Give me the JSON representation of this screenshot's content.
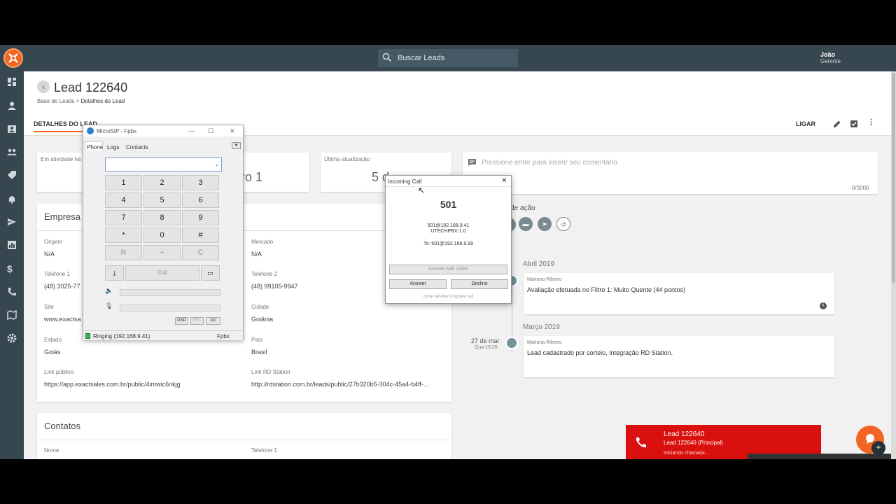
{
  "topbar": {
    "search_placeholder": "Buscar Leads",
    "user_name": "João",
    "user_role": "Gerente"
  },
  "header": {
    "title": "Lead 122640",
    "breadcrumb": [
      "Base de Leads",
      "Detalhes do Lead"
    ],
    "tab": "DETALHES DO LEAD",
    "ligar": "LIGAR"
  },
  "stats": {
    "activity_label": "Em atividade há",
    "filter_value": "ro 1",
    "update_label": "Última atualização",
    "update_value": "5 d"
  },
  "company": {
    "section": "Empresa",
    "origem_label": "Origem",
    "origem": "N/A",
    "mercado_label": "Mercado",
    "mercado": "N/A",
    "tel1_label": "Telefone 1",
    "tel1": "(48) 3025-77",
    "tel2_label": "Telefone 2",
    "tel2": "(48) 99105-9947",
    "site_label": "Site",
    "site": "www.exactsa",
    "cidade_label": "Cidade",
    "cidade": "Goiânia",
    "estado_label": "Estado",
    "estado": "Goiás",
    "pais_label": "País",
    "pais": "Brasil",
    "link_pub_label": "Link público",
    "link_pub": "https://app.exactsales.com.br/public/4imwic6nkjg",
    "link_rd_label": "Link RD Station",
    "link_rd": "http://rdstation.com.br/leads/public/27b320b5-304c-45a4-b4ff-..."
  },
  "contacts": {
    "section": "Contatos",
    "nome_label": "Nome",
    "tel_label": "Telefone 1"
  },
  "comment": {
    "placeholder": "Pressione enter para inserir seu comentário",
    "counter": "0/3000"
  },
  "timeline": {
    "actions_label": "de ação",
    "month1": "Abril 2019",
    "ev1_author": "Mariana Ribeiro",
    "ev1_text": "Avaliação efetuada no Filtro 1: Muito Quente (44 pontos)",
    "month2": "Março 2019",
    "ev2_date": "27 de mar",
    "ev2_time": "Qua 15:25",
    "ev2_author": "Mariana Ribeiro",
    "ev2_text": "Lead cadastrado por sorteio, Integração RD Station."
  },
  "microsip": {
    "title": "MicroSIP - Fpbx",
    "tabs": [
      "Phone",
      "Logs",
      "Contacts"
    ],
    "keys": [
      "1",
      "2",
      "3",
      "4",
      "5",
      "6",
      "7",
      "8",
      "9",
      "*",
      "0",
      "#",
      "R",
      "+",
      "C"
    ],
    "call": "Call",
    "dnd": "DND",
    "rec": "REC",
    "status": "Ringing (192.168.9.41)",
    "account": "Fpbx"
  },
  "incoming": {
    "title": "Incoming Call",
    "number": "501",
    "from": "501@192.168.9.41",
    "agent": "UTECHPBX-1.0",
    "to": "To: 501@192.168.9.99",
    "answer_video": "Answer with Video",
    "answer": "Answer",
    "decline": "Decline",
    "close_hint": "close window to ignore call"
  },
  "toast": {
    "title": "Lead 122640",
    "subtitle": "Lead 122640 (Principal)",
    "status": "Iniciando chamada..."
  },
  "colors": {
    "accent": "#f26522",
    "sidebar": "#37474f",
    "toast": "#d9100d"
  }
}
